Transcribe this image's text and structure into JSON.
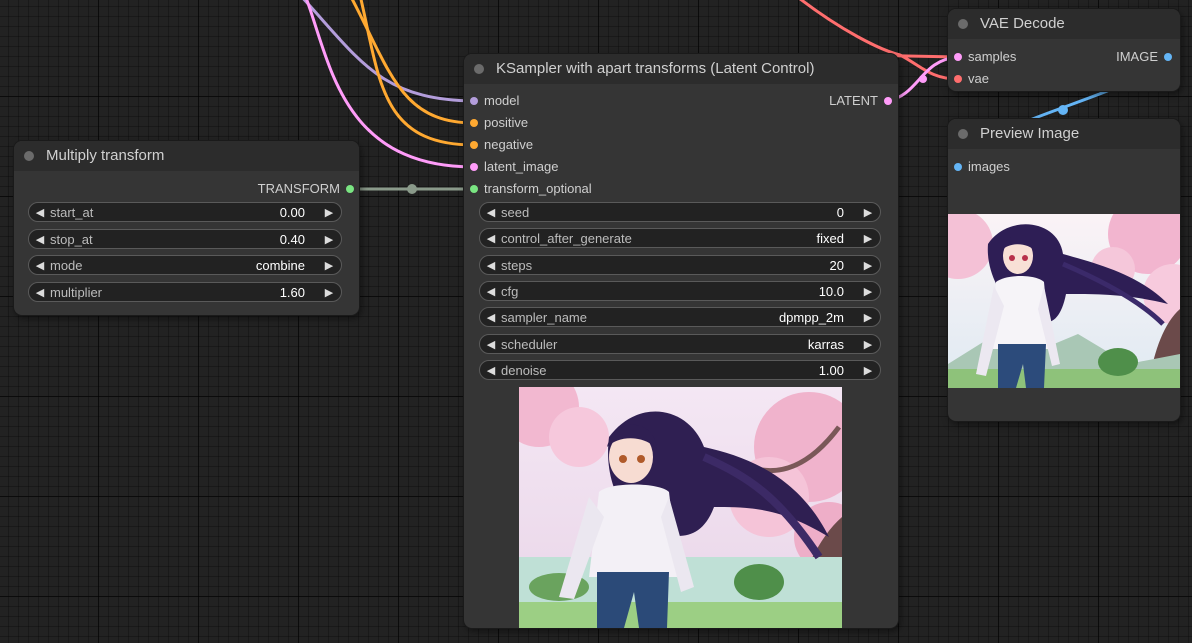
{
  "colors": {
    "model": "#b39ddb",
    "conditioning": "#ffa931",
    "latent": "#ff9cf9",
    "vae": "#ff6e6e",
    "image": "#64b5f6",
    "transform": "#7ae582",
    "transform_wire": "#8a9a8a"
  },
  "multiply": {
    "title": "Multiply transform",
    "output": "TRANSFORM",
    "widgets": [
      {
        "name": "start_at",
        "value": "0.00"
      },
      {
        "name": "stop_at",
        "value": "0.40"
      },
      {
        "name": "mode",
        "value": "combine"
      },
      {
        "name": "multiplier",
        "value": "1.60"
      }
    ]
  },
  "ksampler": {
    "title": "KSampler with apart transforms (Latent Control)",
    "inputs": [
      "model",
      "positive",
      "negative",
      "latent_image",
      "transform_optional"
    ],
    "output": "LATENT",
    "widgets": [
      {
        "name": "seed",
        "value": "0"
      },
      {
        "name": "control_after_generate",
        "value": "fixed"
      },
      {
        "name": "steps",
        "value": "20"
      },
      {
        "name": "cfg",
        "value": "10.0"
      },
      {
        "name": "sampler_name",
        "value": "dpmpp_2m"
      },
      {
        "name": "scheduler",
        "value": "karras"
      },
      {
        "name": "denoise",
        "value": "1.00"
      }
    ]
  },
  "vae_decode": {
    "title": "VAE Decode",
    "inputs": [
      "samples",
      "vae"
    ],
    "output": "IMAGE"
  },
  "preview": {
    "title": "Preview Image",
    "inputs": [
      "images"
    ]
  },
  "icons": {
    "arrow_left": "◀",
    "arrow_right": "▶"
  }
}
